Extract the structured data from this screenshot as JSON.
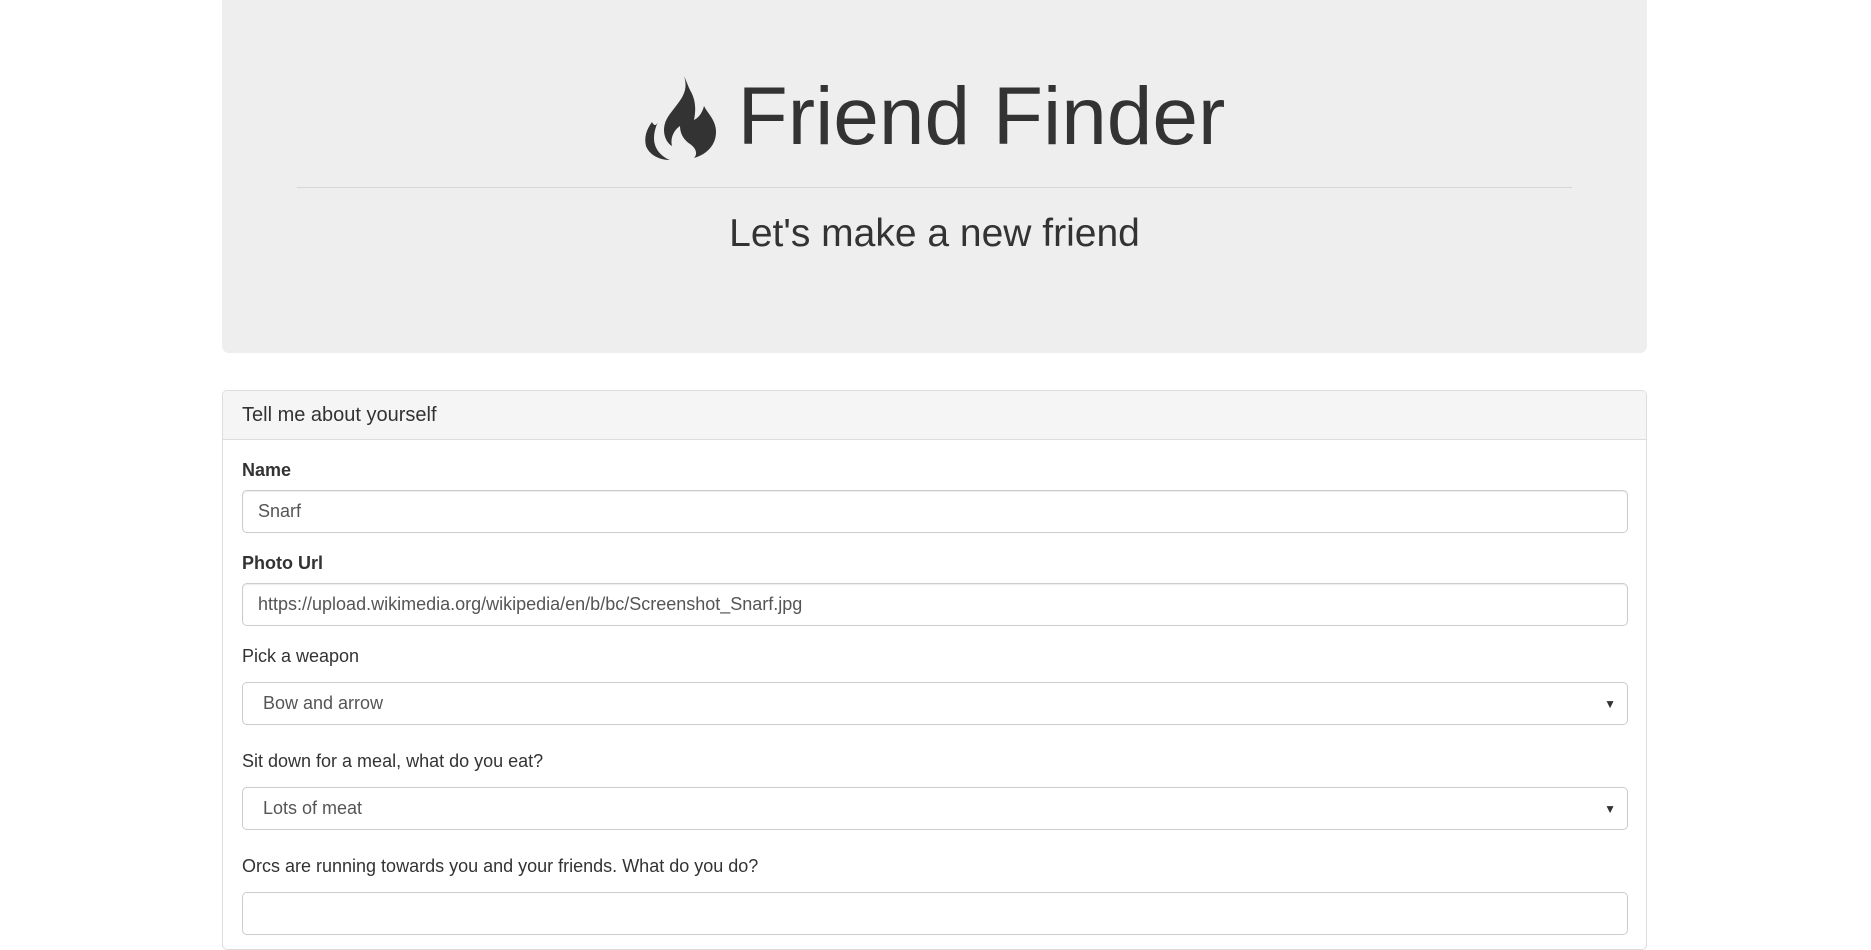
{
  "header": {
    "icon": "fire-icon",
    "title": "Friend Finder",
    "subtitle": "Let's make a new friend"
  },
  "panel": {
    "heading": "Tell me about yourself",
    "name_label": "Name",
    "name_value": "Snarf",
    "photo_label": "Photo Url",
    "photo_value": "https://upload.wikimedia.org/wikipedia/en/b/bc/Screenshot_Snarf.jpg",
    "weapon_label": "Pick a weapon",
    "weapon_selected": "Bow and arrow",
    "meal_label": "Sit down for a meal, what do you eat?",
    "meal_selected": "Lots of meat",
    "orcs_label": "Orcs are running towards you and your friends. What do you do?"
  },
  "colors": {
    "jumbotron_bg": "#eeeeee",
    "text": "#333333",
    "panel_heading_bg": "#f5f5f5",
    "border": "#dddddd"
  }
}
